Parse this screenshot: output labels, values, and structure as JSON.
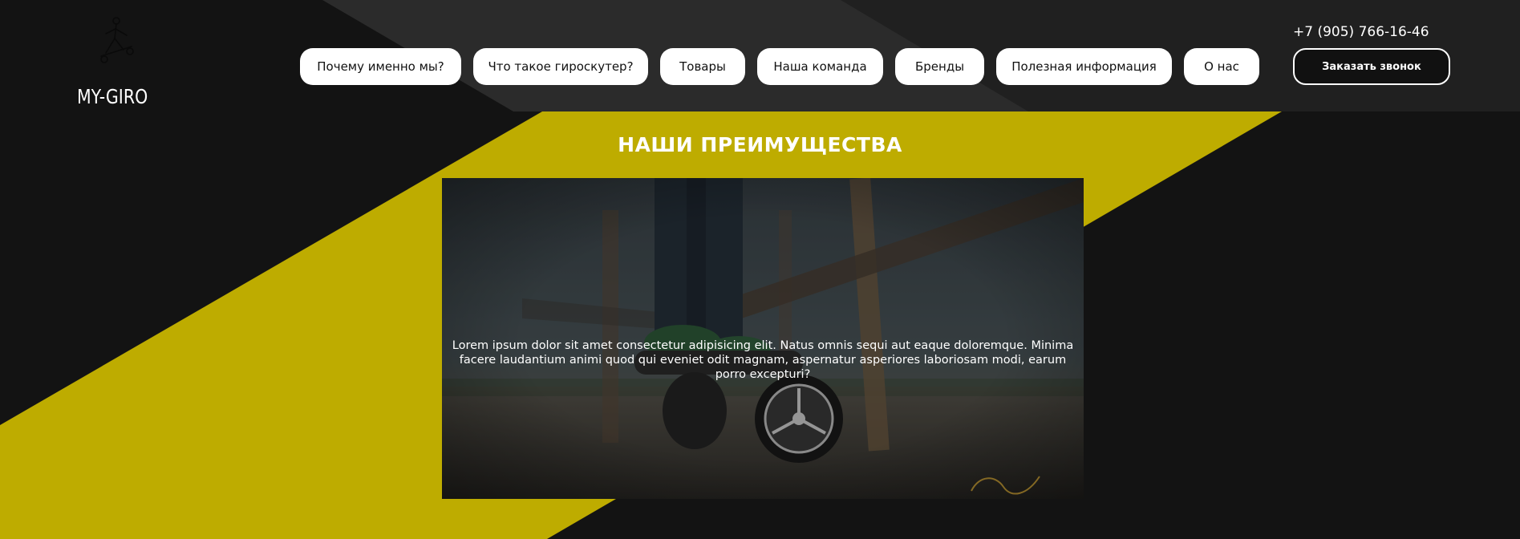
{
  "header": {
    "logo_text": "MY-GIRO",
    "nav": [
      {
        "label": "Почему именно мы?"
      },
      {
        "label": "Что такое гироскутер?"
      },
      {
        "label": "Товары"
      },
      {
        "label": "Наша команда"
      },
      {
        "label": "Бренды"
      },
      {
        "label": "Полезная информация"
      },
      {
        "label": "О нас"
      }
    ],
    "phone": "+7 (905) 766-16-46",
    "callback_label": "Заказать звонок"
  },
  "main": {
    "section_title": "НАШИ ПРЕИМУЩЕСТВА",
    "hero_text": "Lorem ipsum dolor sit amet consectetur adipisicing elit. Natus omnis sequi aut eaque doloremque. Minima facere laudantium animi quod qui eveniet odit magnam, aspernatur asperiores laboriosam modi, earum porro excepturi?"
  },
  "colors": {
    "background": "#131313",
    "accent_yellow": "#beac00",
    "header_stripe": "#2a2a2a",
    "button_bg": "#ffffff"
  },
  "icons": {
    "logo": "hoverboard-rider-icon"
  }
}
